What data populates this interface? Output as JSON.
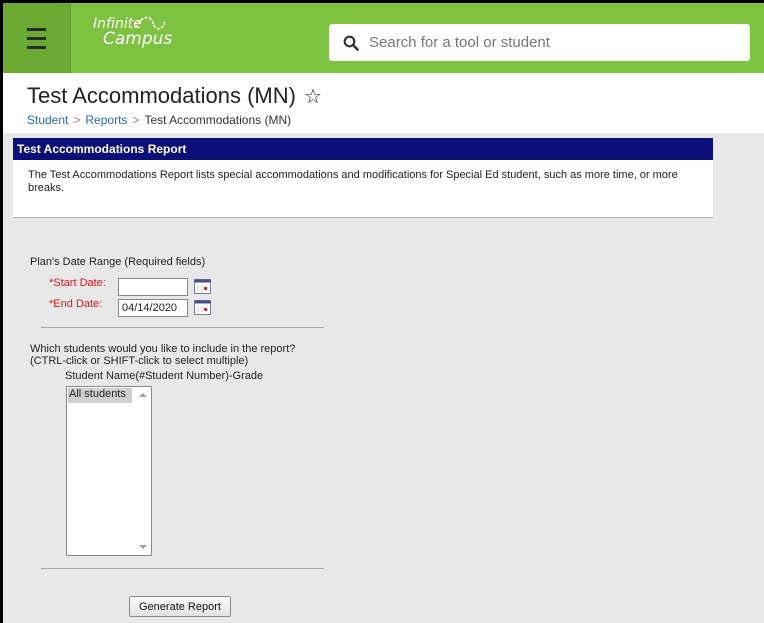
{
  "app": {
    "logo_line1": "Infinite",
    "logo_line2": "Campus",
    "brand_color": "#7ec242"
  },
  "search": {
    "placeholder": "Search for a tool or student",
    "value": ""
  },
  "header": {
    "title": "Test Accommodations (MN)",
    "star_glyph": "☆"
  },
  "breadcrumb": {
    "items": [
      "Student",
      "Reports",
      "Test Accommodations (MN)"
    ],
    "separator": ">"
  },
  "report": {
    "header": "Test Accommodations Report",
    "description": "The Test Accommodations Report lists special accommodations and modifications for Special Ed student, such as more time, or more breaks."
  },
  "form": {
    "date_range_label": "Plan's Date Range (Required fields)",
    "start_date_label": "*Start Date:",
    "start_date_value": "",
    "end_date_label": "*End Date:",
    "end_date_value": "04/14/2020",
    "students_question_line1": "Which students would you like to include in the report?",
    "students_question_line2": "(CTRL-click or SHIFT-click to select multiple)",
    "students_list_header": "Student Name(#Student Number)-Grade",
    "students_options": [
      "All students"
    ],
    "generate_button": "Generate Report"
  },
  "colors": {
    "report_header_bg": "#0c0f7a",
    "required_label": "#d61a1a",
    "link": "#2a6db0"
  },
  "icons": {
    "menu": "hamburger-icon",
    "search": "search-icon",
    "favorite": "star-icon",
    "calendar": "calendar-icon"
  }
}
